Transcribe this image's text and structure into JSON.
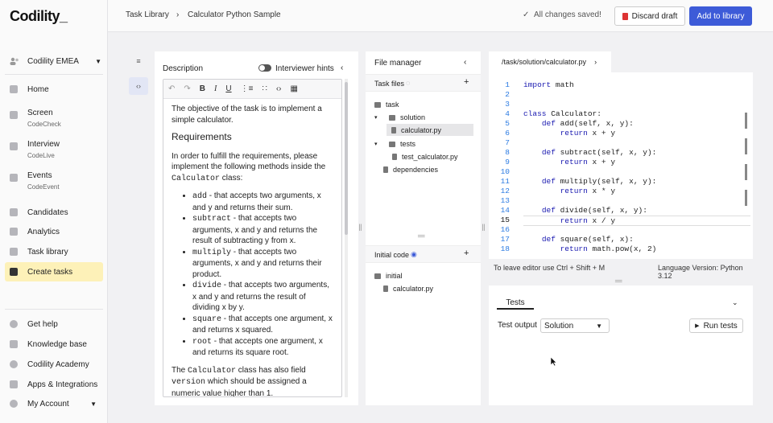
{
  "app": {
    "logo": "Codility_"
  },
  "sidebar": {
    "org": "Codility EMEA",
    "items": [
      {
        "label": "Home"
      },
      {
        "label": "Screen",
        "sub": "CodeCheck"
      },
      {
        "label": "Interview",
        "sub": "CodeLive"
      },
      {
        "label": "Events",
        "sub": "CodeEvent"
      },
      {
        "label": "Candidates"
      },
      {
        "label": "Analytics"
      },
      {
        "label": "Task library"
      },
      {
        "label": "Create tasks"
      }
    ],
    "bottom": [
      {
        "label": "Get help"
      },
      {
        "label": "Knowledge base"
      },
      {
        "label": "Codility Academy"
      },
      {
        "label": "Apps & Integrations"
      },
      {
        "label": "My Account"
      }
    ]
  },
  "topbar": {
    "crumb1": "Task Library",
    "crumb_sep": "›",
    "crumb2": "Calculator Python Sample",
    "saved": "All changes saved!",
    "discard": "Discard draft",
    "add": "Add to library"
  },
  "description": {
    "title": "Description",
    "hints_label": "Interviewer hints",
    "p1": "The objective of the task is to implement a simple calculator.",
    "h": "Requirements",
    "p2a": "In order to fulfill the requirements, please implement the following methods inside the ",
    "p2code": "Calculator",
    "p2b": " class:",
    "methods": [
      {
        "name": "add",
        "text": " - that accepts two arguments, x and y and returns their sum."
      },
      {
        "name": "subtract",
        "text": " - that accepts two arguments, x and y and returns the result of subtracting y from x."
      },
      {
        "name": "multiply",
        "text": " - that accepts two arguments, x and y and returns their product."
      },
      {
        "name": "divide",
        "text": " - that accepts two arguments, x and y and returns the result of dividing x by y."
      },
      {
        "name": "square",
        "text": " - that accepts one argument, x and returns x squared."
      },
      {
        "name": "root",
        "text": " - that accepts one argument, x and returns its square root."
      }
    ],
    "p3a": "The ",
    "p3code": "Calculator",
    "p3b": " class has also field ",
    "p3code2": "version",
    "p3c": " which should be assigned a numeric value higher than 1."
  },
  "file_manager": {
    "title": "File manager",
    "task_files_label": "Task files",
    "tree": {
      "task": "task",
      "solution": "solution",
      "calculator": "calculator.py",
      "tests": "tests",
      "test_calculator": "test_calculator.py",
      "dependencies": "dependencies"
    },
    "initial_code_label": "Initial code",
    "initial_tree": {
      "initial": "initial",
      "calculator": "calculator.py"
    }
  },
  "code": {
    "path": "/task/solution/calculator.py",
    "lines": [
      "1",
      "2",
      "3",
      "4",
      "5",
      "6",
      "7",
      "8",
      "9",
      "10",
      "11",
      "12",
      "13",
      "14",
      "15",
      "16",
      "17",
      "18"
    ],
    "hint": "To leave editor use Ctrl + Shift + M",
    "lang": "Language Version: Python 3.12"
  },
  "tests": {
    "tab": "Tests",
    "output_label": "Test output",
    "output_value": "Solution",
    "run": "Run tests"
  }
}
